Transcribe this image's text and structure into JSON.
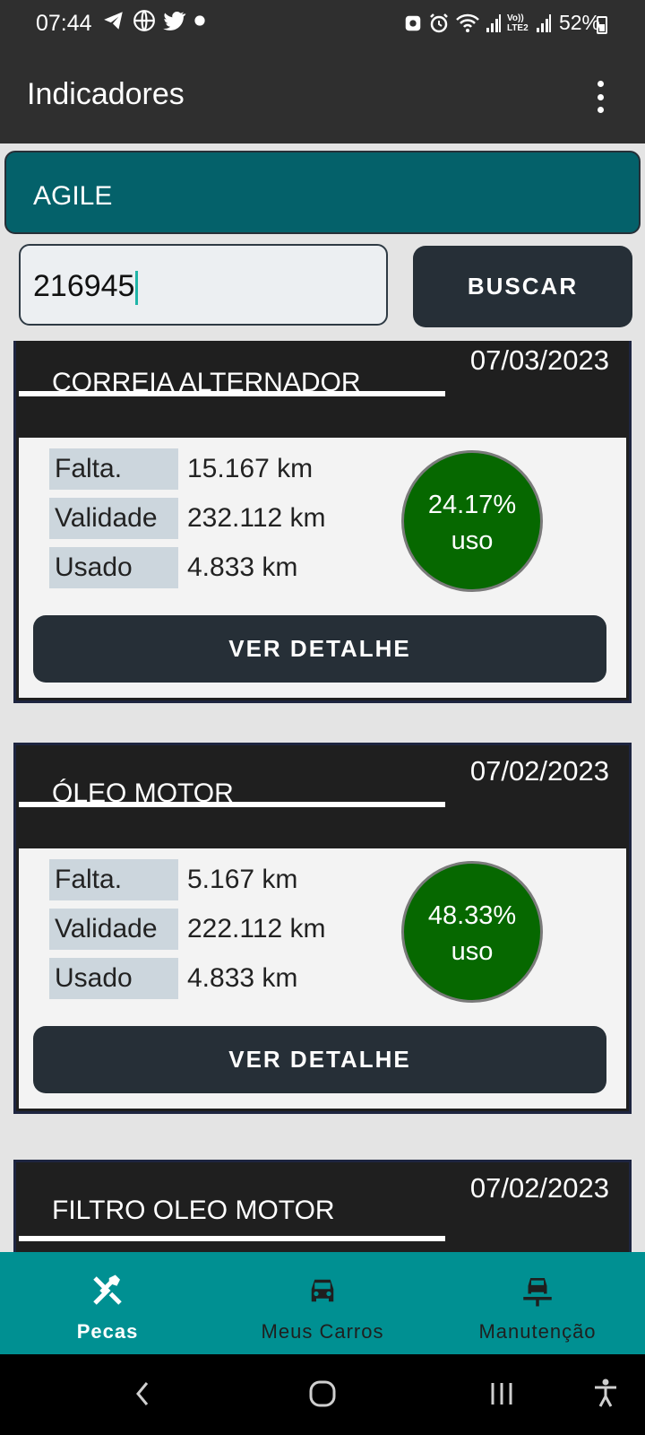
{
  "status_bar": {
    "time": "07:44",
    "left_icons": [
      "telegram-icon",
      "globe-icon",
      "twitter-icon",
      "dot-icon"
    ],
    "right_icons": [
      "screenshot-icon",
      "alarm-icon",
      "wifi-icon",
      "signal-icon",
      "volte-icon",
      "signal-icon"
    ],
    "volte_text": "Vo)) LTE2",
    "battery": "52%"
  },
  "app_bar": {
    "title": "Indicadores"
  },
  "vehicle": {
    "name": "AGILE"
  },
  "search": {
    "value": "216945",
    "button_label": "BUSCAR"
  },
  "parts": [
    {
      "title": "CORREIA ALTERNADOR",
      "date": "07/03/2023",
      "rows": [
        {
          "label": "Falta.",
          "value": "15.167 km"
        },
        {
          "label": "Validade",
          "value": "232.112 km"
        },
        {
          "label": "Usado",
          "value": "4.833 km"
        }
      ],
      "usage_pct": "24.17%",
      "usage_label": "uso",
      "button_label": "VER DETALHE"
    },
    {
      "title": "ÓLEO MOTOR",
      "date": "07/02/2023",
      "rows": [
        {
          "label": "Falta.",
          "value": "5.167 km"
        },
        {
          "label": "Validade",
          "value": "222.112 km"
        },
        {
          "label": "Usado",
          "value": "4.833 km"
        }
      ],
      "usage_pct": "48.33%",
      "usage_label": "uso",
      "button_label": "VER DETALHE"
    },
    {
      "title": "FILTRO OLEO MOTOR",
      "date": "07/02/2023"
    }
  ],
  "bottom_nav": {
    "items": [
      {
        "label": "Pecas",
        "icon": "tools-icon",
        "active": true
      },
      {
        "label": "Meus Carros",
        "icon": "car-icon",
        "active": false
      },
      {
        "label": "Manutenção",
        "icon": "car-lift-icon",
        "active": false
      }
    ]
  },
  "colors": {
    "app_bar": "#2f2f2f",
    "vehicle_bar": "#04616a",
    "button": "#262f37",
    "gauge": "#066800",
    "bottom_nav": "#009092"
  }
}
